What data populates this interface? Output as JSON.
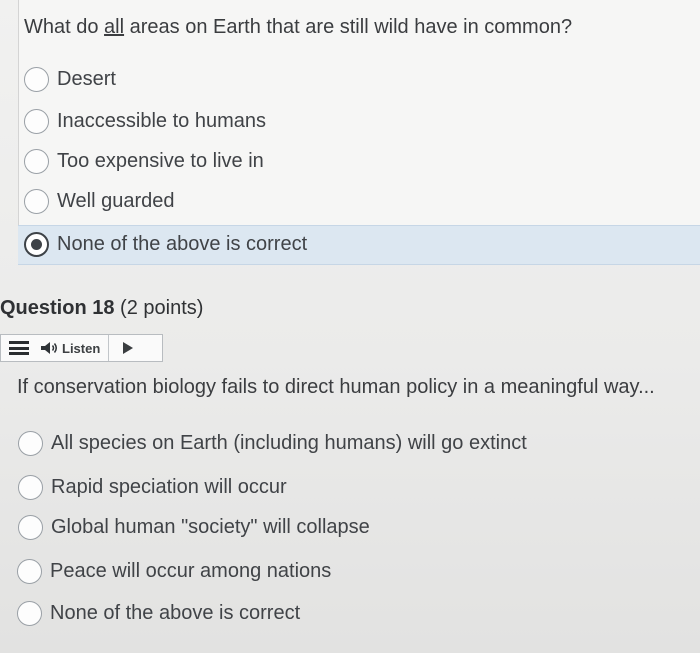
{
  "question17": {
    "prompt_before": "What do ",
    "prompt_emphasis": "all",
    "prompt_after": " areas on Earth that are still wild have in common?",
    "options": [
      {
        "label": "Desert",
        "selected": false
      },
      {
        "label": "Inaccessible to humans",
        "selected": false
      },
      {
        "label": "Too expensive to live in",
        "selected": false
      },
      {
        "label": "Well guarded",
        "selected": false
      },
      {
        "label": "None of the above is correct",
        "selected": true
      }
    ]
  },
  "question18": {
    "title": "Question 18",
    "points": "(2 points)",
    "toolbar": {
      "menu_icon": "hamburger-menu-icon",
      "speaker_icon": "speaker-icon",
      "listen_label": "Listen",
      "play_icon": "play-icon"
    },
    "prompt": "If conservation biology fails to direct human policy in a meaningful way...",
    "options": [
      {
        "label": "All species on Earth (including humans) will go extinct",
        "selected": false
      },
      {
        "label": "Rapid speciation will occur",
        "selected": false
      },
      {
        "label": "Global human \"society\" will collapse",
        "selected": false
      },
      {
        "label": "Peace will occur among nations",
        "selected": false
      },
      {
        "label": "None of the above is correct",
        "selected": false
      }
    ]
  },
  "colors": {
    "selected_highlight": "#dce7f1",
    "text": "#3a3c3f",
    "radio_border": "#9aa0a6"
  }
}
